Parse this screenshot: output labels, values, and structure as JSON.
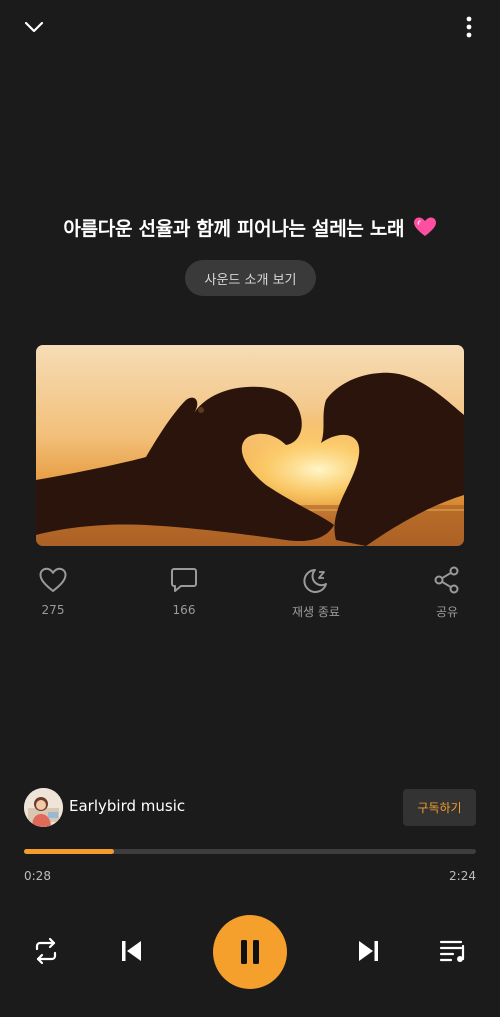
{
  "header": {
    "collapse_icon": "chevron-down-icon",
    "more_icon": "more-vertical-icon"
  },
  "track": {
    "title": "아름다운 선율과 함께 피어나는 설레는 노래",
    "title_emoji": "💓"
  },
  "sound_intro_button": "사운드 소개 보기",
  "cover_image": "hands-heart-sunset",
  "actions": [
    {
      "icon": "heart-icon",
      "label": "275"
    },
    {
      "icon": "comment-icon",
      "label": "166"
    },
    {
      "icon": "sleep-timer-icon",
      "label": "재생 종료"
    },
    {
      "icon": "share-icon",
      "label": "공유"
    }
  ],
  "channel": {
    "name": "Earlybird music",
    "subscribe_label": "구독하기"
  },
  "player": {
    "current_time": "0:28",
    "total_time": "2:24",
    "progress": 0.2,
    "accent_color": "#f5a02c"
  },
  "controls": {
    "repeat_icon": "repeat-icon",
    "prev_icon": "skip-previous-icon",
    "play_state_icon": "pause-icon",
    "next_icon": "skip-next-icon",
    "queue_icon": "playlist-icon"
  }
}
